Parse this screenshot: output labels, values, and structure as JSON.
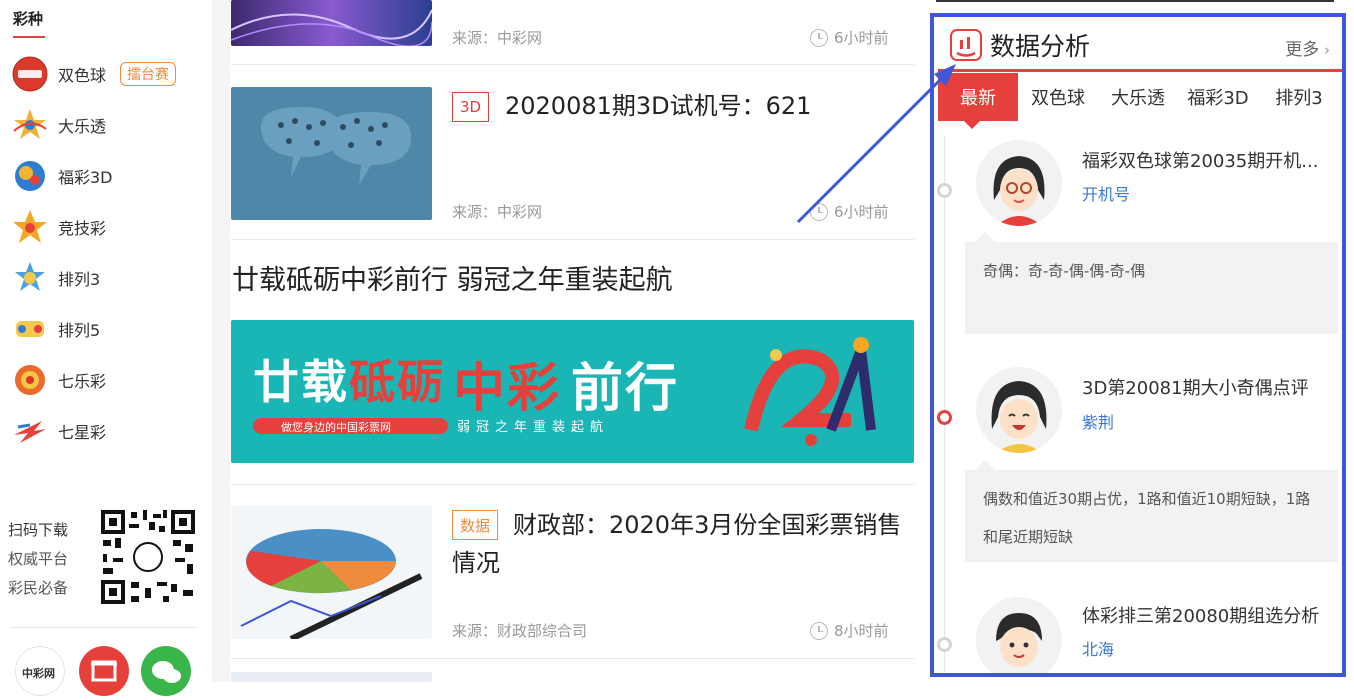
{
  "sidebar": {
    "title": "彩种",
    "items": [
      {
        "label": "双色球",
        "badge": "擂台赛",
        "icon": "ssq-ball-icon",
        "color": "#d93a2b"
      },
      {
        "label": "大乐透",
        "icon": "dlt-star-icon",
        "color": "#f2b233"
      },
      {
        "label": "福彩3D",
        "icon": "fc3d-icon",
        "color": "#2e7dd1"
      },
      {
        "label": "竞技彩",
        "icon": "jjc-star-icon",
        "color": "#f5a623"
      },
      {
        "label": "排列3",
        "icon": "pl3-icon",
        "color": "#4aa3df"
      },
      {
        "label": "排列5",
        "icon": "pl5-icon",
        "color": "#f2c94c"
      },
      {
        "label": "七乐彩",
        "icon": "qlc-icon",
        "color": "#e96a2b"
      },
      {
        "label": "七星彩",
        "icon": "qxc-icon",
        "color": "#e5403b"
      }
    ],
    "qr_lines": [
      "扫码下载",
      "权威平台",
      "彩民必备"
    ],
    "bottom_icons": [
      "zhongcai-logo-icon",
      "store-icon",
      "wechat-icon"
    ],
    "bottom_logo_text": "中彩网"
  },
  "main": {
    "articles": [
      {
        "source": "来源：中彩网",
        "time": "6小时前"
      },
      {
        "tag": "3D",
        "title": "2020081期3D试机号：621",
        "source": "来源：中彩网",
        "time": "6小时前"
      },
      {
        "headline": "廿载砥砺中彩前行 弱冠之年重装起航",
        "banner": {
          "text1": "廿载",
          "text2": "砥砺",
          "text3": "中彩",
          "text4": "前行",
          "slogan": "做您身边的中国彩票网",
          "sub": "弱冠之年重装起航"
        }
      },
      {
        "tag": "数据",
        "title_line1": "财政部：2020年3月份全国彩票销售",
        "title_line2": "情况",
        "source": "来源：财政部综合司",
        "time": "8小时前"
      }
    ]
  },
  "panel": {
    "title": "数据分析",
    "more": "更多",
    "tabs": [
      "最新",
      "双色球",
      "大乐透",
      "福彩3D",
      "排列3"
    ],
    "active_tab": "最新",
    "posts": [
      {
        "title": "福彩双色球第20035期开机...",
        "author": "开机号",
        "summary": "奇偶：奇-奇-偶-偶-奇-偶"
      },
      {
        "title": "3D第20081期大小奇偶点评",
        "author": "紫荆",
        "summary": "偶数和值近30期占优，1路和值近10期短缺，1路和尾近期短缺"
      },
      {
        "title": "体彩排三第20080期组选分析",
        "author": "北海"
      }
    ]
  },
  "colors": {
    "accent": "#e5403b",
    "highlight_border": "#3e57d9",
    "link": "#3a78d8"
  }
}
